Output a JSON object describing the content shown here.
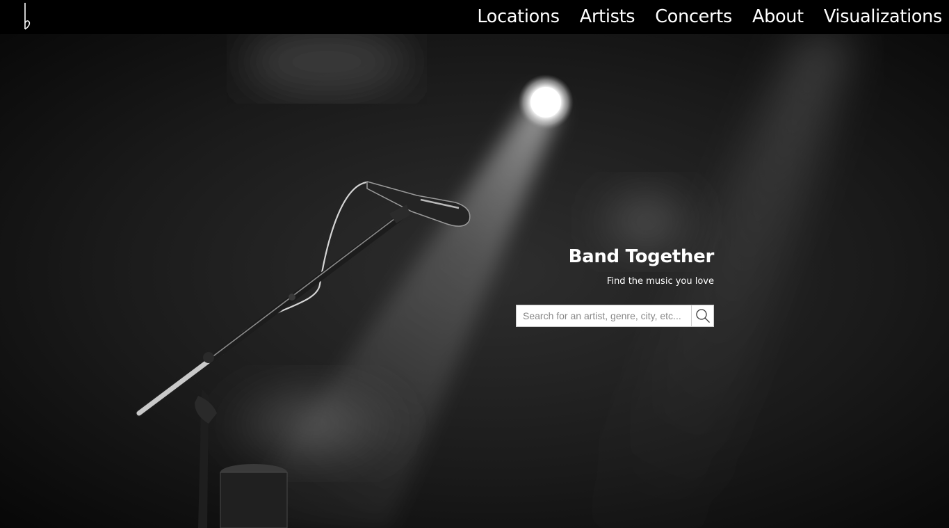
{
  "nav": {
    "brand_icon": "flat-note-icon",
    "links": [
      {
        "label": "Locations"
      },
      {
        "label": "Artists"
      },
      {
        "label": "Concerts"
      },
      {
        "label": "About"
      },
      {
        "label": "Visualizations"
      }
    ]
  },
  "hero": {
    "background": "microphone-spotlight-photo",
    "title": "Band Together",
    "subtitle": "Find the music you love",
    "search": {
      "placeholder": "Search for an artist, genre, city, etc...",
      "value": "",
      "button_icon": "search-icon"
    }
  },
  "colors": {
    "navbar": "#000000",
    "text": "#ffffff",
    "input_bg": "#ffffff"
  }
}
